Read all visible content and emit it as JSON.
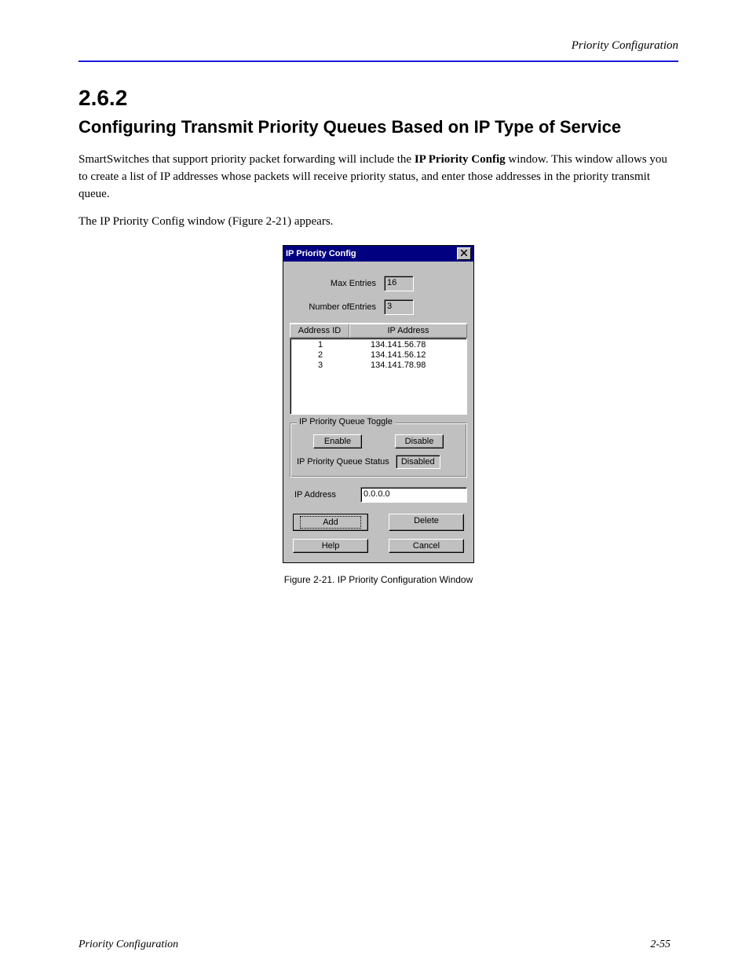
{
  "running_header": "Priority Configuration",
  "chapter_number": "2.6.2",
  "section_title": "Configuring Transmit Priority Queues Based on IP Type of Service",
  "para1_prefix": "SmartSwitches that support priority packet forwarding will include the ",
  "para1_bold": "IP Priority Config",
  "para1_suffix": " window. This window allows you to create a list of IP addresses whose packets will receive priority status, and enter those addresses in the priority transmit queue.",
  "para2_prefix": "The IP Priority Config window (",
  "para2_link": "Figure 2-21",
  "para2_suffix": ") appears.",
  "dialog": {
    "title": "IP Priority Config",
    "max_entries_label": "Max Entries",
    "max_entries_value": "16",
    "num_entries_label": "Number ofEntries",
    "num_entries_value": "3",
    "col_address_id": "Address ID",
    "col_ip_address": "IP Address",
    "rows": [
      {
        "id": "1",
        "ip": "134.141.56.78"
      },
      {
        "id": "2",
        "ip": "134.141.56.12"
      },
      {
        "id": "3",
        "ip": "134.141.78.98"
      }
    ],
    "group_legend": "IP Priority Queue Toggle",
    "enable_label": "Enable",
    "disable_label": "Disable",
    "status_label": "IP Priority Queue Status",
    "status_value": "Disabled",
    "ip_address_label": "IP Address",
    "ip_address_value": "0.0.0.0",
    "add_label": "Add",
    "delete_label": "Delete",
    "help_label": "Help",
    "cancel_label": "Cancel"
  },
  "caption": "Figure 2-21. IP Priority Configuration Window",
  "footer_left": "Priority Configuration",
  "footer_right": "2-55"
}
